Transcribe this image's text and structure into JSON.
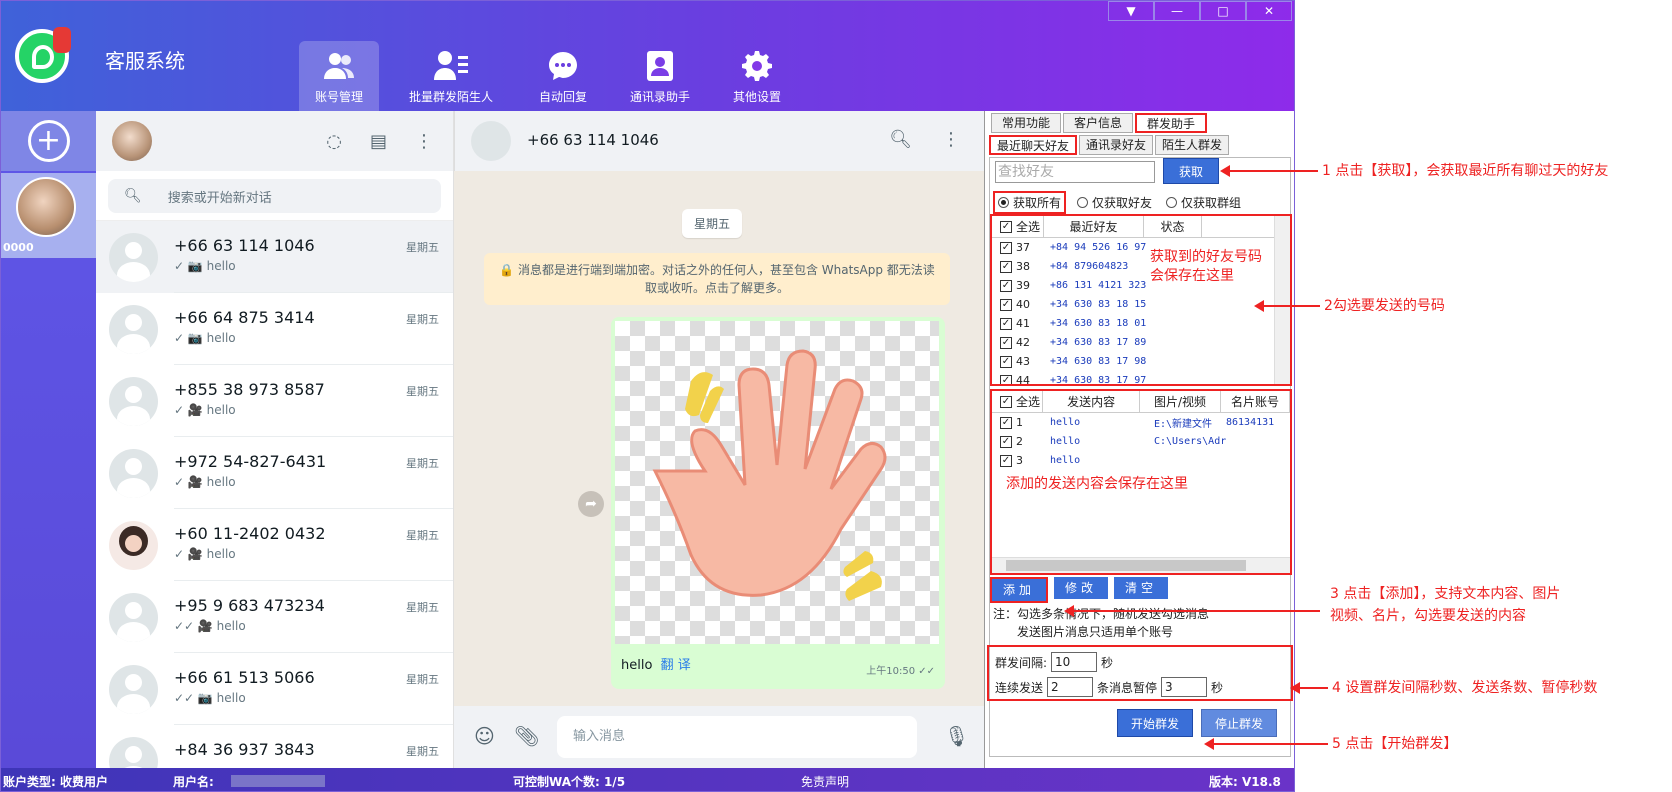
{
  "app": {
    "title": "客服系统",
    "nav": [
      {
        "label": "账号管理",
        "icon": "users-icon",
        "active": true
      },
      {
        "label": "批量群发陌生人",
        "icon": "user-list-icon",
        "active": false
      },
      {
        "label": "自动回复",
        "icon": "chat-bubble-icon",
        "active": false
      },
      {
        "label": "通讯录助手",
        "icon": "contact-book-icon",
        "active": false
      },
      {
        "label": "其他设置",
        "icon": "gear-icon",
        "active": false
      }
    ],
    "window_controls": [
      "▼",
      "—",
      "□",
      "✕"
    ]
  },
  "accounts": {
    "add_label": "+",
    "current_id": "0000"
  },
  "chatlist": {
    "search_placeholder": "搜索或开始新对话",
    "chats": [
      {
        "name": "+66 63 114 1046",
        "time": "星期五",
        "last": "✓ 📷 hello",
        "selected": true
      },
      {
        "name": "+66 64 875 3414",
        "time": "星期五",
        "last": "✓ 📷 hello"
      },
      {
        "name": "+855 38 973 8587",
        "time": "星期五",
        "last": "✓ 🎥 hello"
      },
      {
        "name": "+972 54-827-6431",
        "time": "星期五",
        "last": "✓ 🎥 hello"
      },
      {
        "name": "+60 11-2402 0432",
        "time": "星期五",
        "last": "✓ 🎥 hello"
      },
      {
        "name": "+95 9 683 473234",
        "time": "星期五",
        "last": "✓✓ 🎥 hello"
      },
      {
        "name": "+66 61 513 5066",
        "time": "星期五",
        "last": "✓✓ 📷 hello"
      },
      {
        "name": "+84 36 937 3843",
        "time": "星期五",
        "last": ""
      }
    ]
  },
  "chatpane": {
    "contact": "+66 63 114 1046",
    "day": "星期五",
    "encryption_note": "🔒 消息都是进行端到端加密。对话之外的任何人，甚至包含 WhatsApp 都无法读取或收听。点击了解更多。",
    "caption": "hello",
    "translate": "翻 译",
    "msg_time": "上午10:50 ✓✓",
    "input_placeholder": "输入消息"
  },
  "panel": {
    "tabs_top": [
      "常用功能",
      "客户信息",
      "群发助手"
    ],
    "tabs_sub": [
      "最近聊天好友",
      "通讯录好友",
      "陌生人群发"
    ],
    "find_placeholder": "查找好友",
    "fetch_label": "获取",
    "radios": [
      {
        "label": "获取所有",
        "on": true
      },
      {
        "label": "仅获取好友",
        "on": false
      },
      {
        "label": "仅获取群组",
        "on": false
      }
    ],
    "friends_header": {
      "all": "全选",
      "col1": "最近好友",
      "col2": "状态"
    },
    "friends": [
      {
        "idx": "37",
        "num": "+84 94 526 16 97"
      },
      {
        "idx": "38",
        "num": "+84 879604823"
      },
      {
        "idx": "39",
        "num": "+86 131 4121 323"
      },
      {
        "idx": "40",
        "num": "+34 630 83 18 15"
      },
      {
        "idx": "41",
        "num": "+34 630 83 18 01"
      },
      {
        "idx": "42",
        "num": "+34 630 83 17 89"
      },
      {
        "idx": "43",
        "num": "+34 630 83 17 98"
      },
      {
        "idx": "44",
        "num": "+34 630 83 17 97"
      }
    ],
    "friends_note": "获取到的好友号码\n会保存在这里",
    "content_header": {
      "all": "全选",
      "col1": "发送内容",
      "col2": "图片/视频",
      "col3": "名片账号"
    },
    "contents": [
      {
        "idx": "1",
        "text": "hello",
        "media": "E:\\新建文件",
        "card": "86134131"
      },
      {
        "idx": "2",
        "text": "hello",
        "media": "C:\\Users\\Adr",
        "card": ""
      },
      {
        "idx": "3",
        "text": "hello",
        "media": "",
        "card": ""
      }
    ],
    "content_note": "添加的发送内容会保存在这里",
    "btn_add": "添加",
    "btn_edit": "修改",
    "btn_clear": "清空",
    "note_line1": "注：勾选多条情况下，随机发送勾选消息",
    "note_line2": "发送图片消息只适用单个账号",
    "interval_label": "群发间隔:",
    "interval_value": "10",
    "sec": "秒",
    "continuous_label": "连续发送",
    "continuous_value": "2",
    "pause_label": "条消息暂停",
    "pause_value": "3",
    "start_label": "开始群发",
    "stop_label": "停止群发"
  },
  "statusbar": {
    "account_type": "账户类型: 收费用户",
    "username_label": "用户名:",
    "controllable": "可控制WA个数: 1/5",
    "disclaimer": "免责声明",
    "version": "版本: V18.8"
  },
  "annotations": {
    "a1": "1 点击【获取】，会获取最近所有聊过天的好友",
    "a2": "2勾选要发送的号码",
    "a3_line1": "3 点击【添加】，支持文本内容、图片",
    "a3_line2": "视频、名片，勾选要发送的内容",
    "a4": "4 设置群发间隔秒数、发送条数、暂停秒数",
    "a5": "5 点击【开始群发】"
  },
  "colors": {
    "accent": "#3a6fd8",
    "annotation": "#e22222",
    "header_from": "#3f62d9",
    "header_to": "#8e2bea"
  }
}
